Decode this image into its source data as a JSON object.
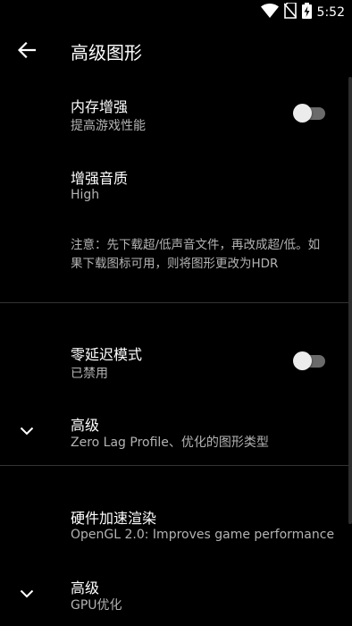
{
  "status_bar": {
    "time": "5:52",
    "icons": [
      "wifi-icon",
      "no-sim-icon",
      "battery-charging-icon"
    ]
  },
  "app_bar": {
    "back_icon": "arrow-back-icon",
    "title": "高级图形"
  },
  "preferences": {
    "memory_boost": {
      "title": "内存增强",
      "summary": "提高游戏性能",
      "enabled": false
    },
    "audio_quality": {
      "title": "增强音质",
      "summary": "High"
    },
    "note": "注意：先下载超/低声音文件，再改成超/低。如果下载图标可用，则将图形更改为HDR",
    "zero_lag": {
      "title": "零延迟模式",
      "summary": "已禁用",
      "enabled": false
    },
    "advanced_1": {
      "title": "高级",
      "summary": "Zero Lag Profile、优化的图形类型",
      "icon": "chevron-down-icon"
    },
    "hw_render": {
      "title": "硬件加速渲染",
      "summary": "OpenGL 2.0: Improves game performance"
    },
    "advanced_2": {
      "title": "高级",
      "summary": "GPU优化",
      "icon": "chevron-down-icon"
    }
  },
  "colors": {
    "background": "#000000",
    "text_primary": "#ffffff",
    "text_secondary": "#b3b3b3",
    "switch_track_off": "#6a6a6a",
    "switch_thumb_off": "#ececec",
    "divider": "#333333"
  }
}
